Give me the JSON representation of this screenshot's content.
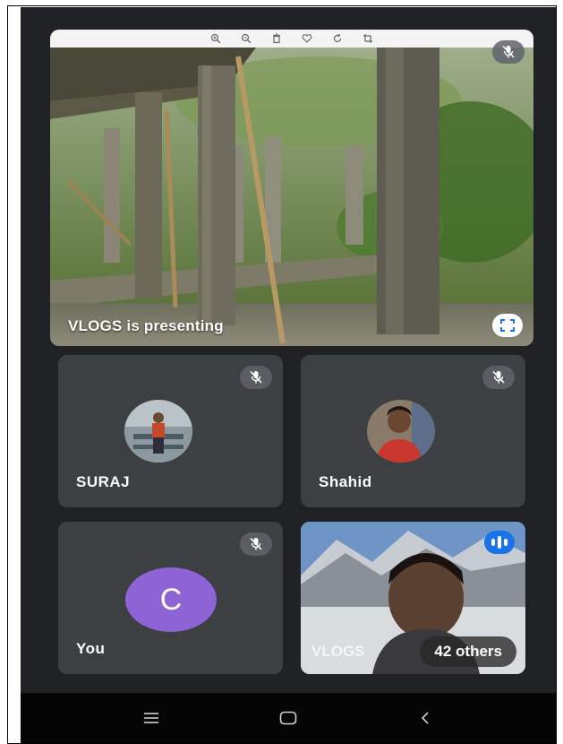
{
  "presentation": {
    "label": "VLOGS is presenting",
    "toolbar_icons": [
      "zoom-in-icon",
      "zoom-out-icon",
      "trash-icon",
      "heart-icon",
      "rotate-icon",
      "crop-icon"
    ]
  },
  "participants": [
    {
      "name": "SURAJ",
      "muted": true
    },
    {
      "name": "Shahid",
      "muted": true
    },
    {
      "name": "You",
      "avatar_letter": "C",
      "avatar_color": "#8e63d6",
      "muted": true
    }
  ],
  "speaker_tile": {
    "name_faint": "VLOGS",
    "others_label": "42 others"
  },
  "colors": {
    "background": "#202124",
    "tile": "#3c4043",
    "speaking_accent": "#1a73e8",
    "navbar": "#050505"
  },
  "navbar": {
    "icons": [
      "recents-icon",
      "home-icon",
      "back-icon"
    ]
  }
}
